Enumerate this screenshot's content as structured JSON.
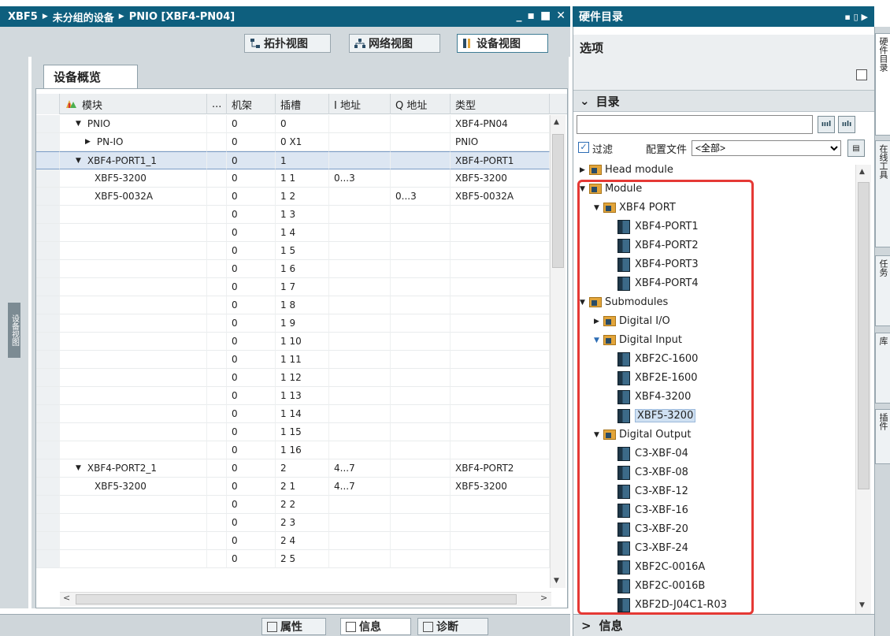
{
  "window": {
    "breadcrumb": [
      "XBF5",
      "未分组的设备",
      "PNIO [XBF4-PN04]"
    ],
    "controls": [
      "_",
      "▪",
      "■",
      "✕"
    ]
  },
  "view_tabs": [
    {
      "label": "拓扑视图",
      "icon": "topology-icon"
    },
    {
      "label": "网络视图",
      "icon": "network-icon"
    },
    {
      "label": "设备视图",
      "icon": "device-icon"
    }
  ],
  "side_label": "设备视图",
  "overview_tab": "设备概览",
  "columns": [
    "模块",
    "...",
    "机架",
    "插槽",
    "I 地址",
    "Q 地址",
    "类型"
  ],
  "rows": [
    {
      "module": "PNIO",
      "rack": "0",
      "slot": "0",
      "i": "",
      "q": "",
      "type": "XBF4-PN04",
      "indent": 1,
      "tri": "▼"
    },
    {
      "module": "PN-IO",
      "rack": "0",
      "slot": "0 X1",
      "i": "",
      "q": "",
      "type": "PNIO",
      "indent": 2,
      "tri": "▶"
    },
    {
      "module": "XBF4-PORT1_1",
      "rack": "0",
      "slot": "1",
      "i": "",
      "q": "",
      "type": "XBF4-PORT1",
      "indent": 1,
      "tri": "▼",
      "selected": true
    },
    {
      "module": "XBF5-3200",
      "rack": "0",
      "slot": "1 1",
      "i": "0...3",
      "q": "",
      "type": "XBF5-3200",
      "indent": 3,
      "tri": ""
    },
    {
      "module": "XBF5-0032A",
      "rack": "0",
      "slot": "1 2",
      "i": "",
      "q": "0...3",
      "type": "XBF5-0032A",
      "indent": 3,
      "tri": ""
    },
    {
      "module": "",
      "rack": "0",
      "slot": "1 3",
      "i": "",
      "q": "",
      "type": "",
      "indent": 0,
      "tri": ""
    },
    {
      "module": "",
      "rack": "0",
      "slot": "1 4",
      "i": "",
      "q": "",
      "type": "",
      "indent": 0,
      "tri": ""
    },
    {
      "module": "",
      "rack": "0",
      "slot": "1 5",
      "i": "",
      "q": "",
      "type": "",
      "indent": 0,
      "tri": ""
    },
    {
      "module": "",
      "rack": "0",
      "slot": "1 6",
      "i": "",
      "q": "",
      "type": "",
      "indent": 0,
      "tri": ""
    },
    {
      "module": "",
      "rack": "0",
      "slot": "1 7",
      "i": "",
      "q": "",
      "type": "",
      "indent": 0,
      "tri": ""
    },
    {
      "module": "",
      "rack": "0",
      "slot": "1 8",
      "i": "",
      "q": "",
      "type": "",
      "indent": 0,
      "tri": ""
    },
    {
      "module": "",
      "rack": "0",
      "slot": "1 9",
      "i": "",
      "q": "",
      "type": "",
      "indent": 0,
      "tri": ""
    },
    {
      "module": "",
      "rack": "0",
      "slot": "1 10",
      "i": "",
      "q": "",
      "type": "",
      "indent": 0,
      "tri": ""
    },
    {
      "module": "",
      "rack": "0",
      "slot": "1 11",
      "i": "",
      "q": "",
      "type": "",
      "indent": 0,
      "tri": ""
    },
    {
      "module": "",
      "rack": "0",
      "slot": "1 12",
      "i": "",
      "q": "",
      "type": "",
      "indent": 0,
      "tri": ""
    },
    {
      "module": "",
      "rack": "0",
      "slot": "1 13",
      "i": "",
      "q": "",
      "type": "",
      "indent": 0,
      "tri": ""
    },
    {
      "module": "",
      "rack": "0",
      "slot": "1 14",
      "i": "",
      "q": "",
      "type": "",
      "indent": 0,
      "tri": ""
    },
    {
      "module": "",
      "rack": "0",
      "slot": "1 15",
      "i": "",
      "q": "",
      "type": "",
      "indent": 0,
      "tri": ""
    },
    {
      "module": "",
      "rack": "0",
      "slot": "1 16",
      "i": "",
      "q": "",
      "type": "",
      "indent": 0,
      "tri": ""
    },
    {
      "module": "XBF4-PORT2_1",
      "rack": "0",
      "slot": "2",
      "i": "4...7",
      "q": "",
      "type": "XBF4-PORT2",
      "indent": 1,
      "tri": "▼"
    },
    {
      "module": "XBF5-3200",
      "rack": "0",
      "slot": "2 1",
      "i": "4...7",
      "q": "",
      "type": "XBF5-3200",
      "indent": 3,
      "tri": ""
    },
    {
      "module": "",
      "rack": "0",
      "slot": "2 2",
      "i": "",
      "q": "",
      "type": "",
      "indent": 0,
      "tri": ""
    },
    {
      "module": "",
      "rack": "0",
      "slot": "2 3",
      "i": "",
      "q": "",
      "type": "",
      "indent": 0,
      "tri": ""
    },
    {
      "module": "",
      "rack": "0",
      "slot": "2 4",
      "i": "",
      "q": "",
      "type": "",
      "indent": 0,
      "tri": ""
    },
    {
      "module": "",
      "rack": "0",
      "slot": "2 5",
      "i": "",
      "q": "",
      "type": "",
      "indent": 0,
      "tri": ""
    }
  ],
  "status_tabs": [
    {
      "label": "属性",
      "icon": "properties-icon"
    },
    {
      "label": "信息",
      "icon": "info-icon"
    },
    {
      "label": "诊断",
      "icon": "diagnostics-icon"
    }
  ],
  "catalog": {
    "title": "硬件目录",
    "options_label": "选项",
    "section": "目录",
    "search_placeholder": "",
    "filter_label": "过滤",
    "profile_label": "配置文件",
    "profile_value": "<全部>",
    "info_label": "信息",
    "tree": [
      {
        "label": "Head module",
        "level": 0,
        "tri": "▶",
        "kind": "folder"
      },
      {
        "label": "Module",
        "level": 0,
        "tri": "▼",
        "kind": "folder"
      },
      {
        "label": "XBF4 PORT",
        "level": 1,
        "tri": "▼",
        "kind": "folder"
      },
      {
        "label": "XBF4-PORT1",
        "level": 2,
        "tri": "",
        "kind": "module"
      },
      {
        "label": "XBF4-PORT2",
        "level": 2,
        "tri": "",
        "kind": "module"
      },
      {
        "label": "XBF4-PORT3",
        "level": 2,
        "tri": "",
        "kind": "module"
      },
      {
        "label": "XBF4-PORT4",
        "level": 2,
        "tri": "",
        "kind": "module"
      },
      {
        "label": "Submodules",
        "level": 0,
        "tri": "▼",
        "kind": "folder"
      },
      {
        "label": "Digital I/O",
        "level": 1,
        "tri": "▶",
        "kind": "folder"
      },
      {
        "label": "Digital Input",
        "level": 1,
        "tri": "▼",
        "kind": "folder",
        "blue": true
      },
      {
        "label": "XBF2C-1600",
        "level": 2,
        "tri": "",
        "kind": "module"
      },
      {
        "label": "XBF2E-1600",
        "level": 2,
        "tri": "",
        "kind": "module"
      },
      {
        "label": "XBF4-3200",
        "level": 2,
        "tri": "",
        "kind": "module"
      },
      {
        "label": "XBF5-3200",
        "level": 2,
        "tri": "",
        "kind": "module",
        "highlight": true
      },
      {
        "label": "Digital Output",
        "level": 1,
        "tri": "▼",
        "kind": "folder"
      },
      {
        "label": "C3-XBF-04",
        "level": 2,
        "tri": "",
        "kind": "module"
      },
      {
        "label": "C3-XBF-08",
        "level": 2,
        "tri": "",
        "kind": "module"
      },
      {
        "label": "C3-XBF-12",
        "level": 2,
        "tri": "",
        "kind": "module"
      },
      {
        "label": "C3-XBF-16",
        "level": 2,
        "tri": "",
        "kind": "module"
      },
      {
        "label": "C3-XBF-20",
        "level": 2,
        "tri": "",
        "kind": "module"
      },
      {
        "label": "C3-XBF-24",
        "level": 2,
        "tri": "",
        "kind": "module"
      },
      {
        "label": "XBF2C-0016A",
        "level": 2,
        "tri": "",
        "kind": "module"
      },
      {
        "label": "XBF2C-0016B",
        "level": 2,
        "tri": "",
        "kind": "module"
      },
      {
        "label": "XBF2D-J04C1-R03",
        "level": 2,
        "tri": "",
        "kind": "module"
      }
    ]
  },
  "right_vtabs": [
    "硬件目录",
    "在线工具",
    "任务",
    "库",
    "插件"
  ],
  "colors": {
    "title_bar": "#0e5f7e",
    "panel_bg": "#d2d9dd",
    "selection": "#dce6f2",
    "annotation_red": "#e53935"
  }
}
